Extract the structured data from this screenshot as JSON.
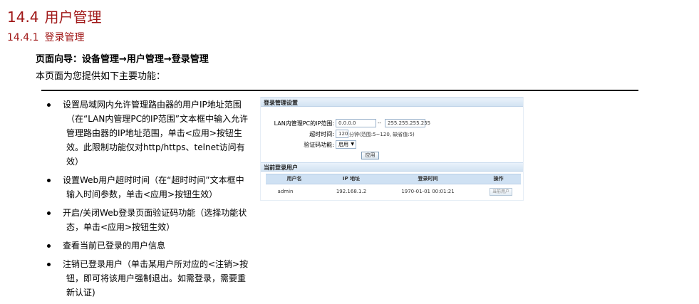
{
  "heading1": {
    "number": "14.4",
    "title": "用户管理"
  },
  "heading2": {
    "number": "14.4.1",
    "title": "登录管理"
  },
  "guide": "页面向导：设备管理→用户管理→登录管理",
  "intro": "本页面为您提供如下主要功能：",
  "features": [
    {
      "first": "设置局域网内允许管理路由器的用户IP地址范围",
      "rest": "（在“LAN内管理PC的IP范围”文本框中输入允许管理路由器的IP地址范围，单击<应用>按钮生效。此限制功能仅对http/https、telnet访问有效）"
    },
    {
      "first": "设置Web用户超时时间（在“超时时间”文本框中",
      "rest": "输入时间参数，单击<应用>按钮生效）"
    },
    {
      "first": "开启/关闭Web登录页面验证码功能（选择功能状",
      "rest": "态，单击<应用>按钮生效）"
    },
    {
      "first": "查看当前已登录的用户信息",
      "rest": ""
    },
    {
      "first": "注销已登录用户（单击某用户所对应的<注销>按",
      "rest": "钮，即可将该用户强制退出。如需登录，需要重新认证)"
    }
  ],
  "panel": {
    "section1_title": "登录管理设置",
    "ip_range_label": "LAN内管理PC的IP范围:",
    "ip_start": "0.0.0.0",
    "ip_sep": "--",
    "ip_end": "255.255.255.255",
    "timeout_label": "超时时间:",
    "timeout_value": "120",
    "timeout_hint": "分钟(范围:5~120, 缺省值:5)",
    "captcha_label": "验证码功能:",
    "captcha_value": "启用",
    "apply_button": "应用",
    "section2_title": "当前登录用户",
    "table_headers": [
      "用户名",
      "IP 地址",
      "登录时间",
      "操作"
    ],
    "table_rows": [
      {
        "username": "admin",
        "ip": "192.168.1.2",
        "login_time": "1970-01-01 00:01:21",
        "action": "当前用户"
      }
    ]
  }
}
